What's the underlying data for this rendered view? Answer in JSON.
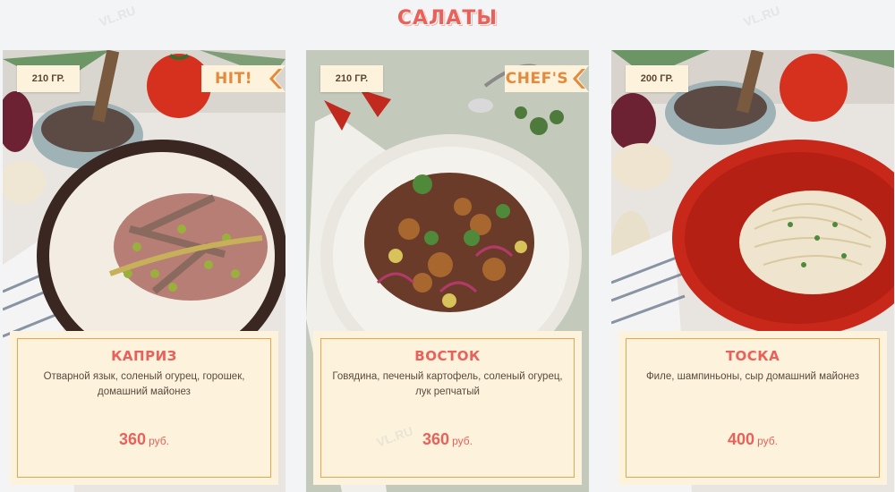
{
  "section": {
    "title": "САЛАТЫ"
  },
  "colors": {
    "accent": "#e8615b",
    "badge_text": "#e38a3c",
    "card_bg": "#fdf3dc",
    "frame": "#e5a74f"
  },
  "items": [
    {
      "weight": "210 ГР.",
      "badge": "HIT!",
      "name": "КАПРИЗ",
      "description": "Отварной язык, соленый огурец, горошек, домашний майонез",
      "price": "360",
      "currency": "руб."
    },
    {
      "weight": "210 ГР.",
      "badge": "CHEF'S",
      "name": "ВОСТОК",
      "description": "Говядина, печеный картофель, соленый огурец, лук репчатый",
      "price": "360",
      "currency": "руб."
    },
    {
      "weight": "200 ГР.",
      "badge": null,
      "name": "ТОСКА",
      "description": "Филе, шампиньоны, сыр домашний майонез",
      "price": "400",
      "currency": "руб."
    }
  ],
  "watermark": "VL.RU"
}
